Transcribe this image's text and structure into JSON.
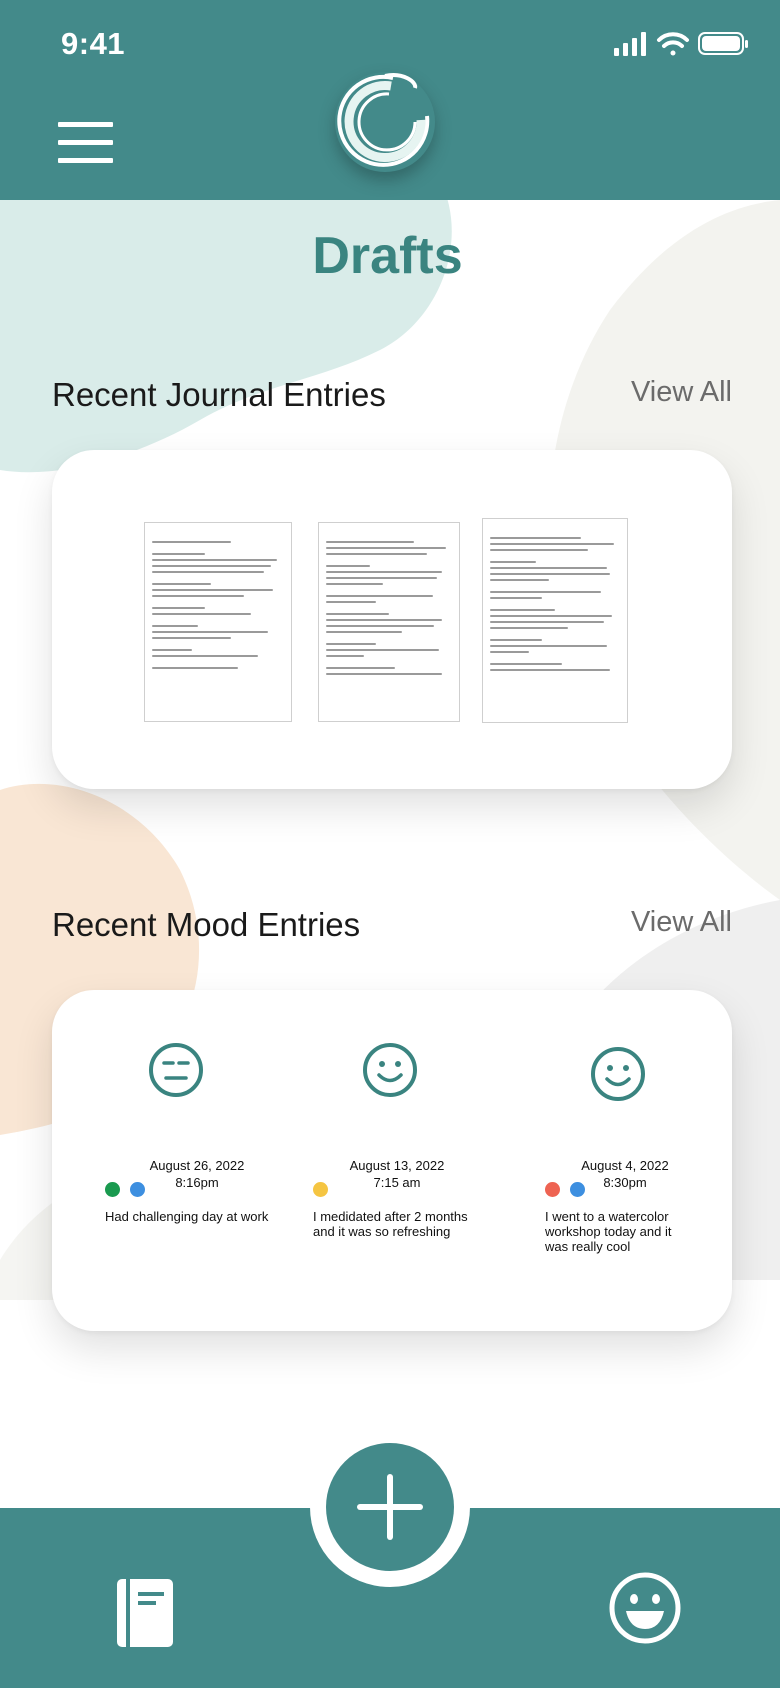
{
  "status_bar": {
    "time": "9:41"
  },
  "header": {
    "menu_icon": "hamburger-menu-icon",
    "logo_icon": "app-logo-icon"
  },
  "page": {
    "title": "Drafts"
  },
  "journal": {
    "section_title": "Recent Journal Entries",
    "view_all_label": "View All",
    "thumbnails": [
      "document-preview-1",
      "document-preview-2",
      "document-preview-3"
    ]
  },
  "mood": {
    "section_title": "Recent Mood Entries",
    "view_all_label": "View All",
    "entries": [
      {
        "date": "August 26, 2022",
        "time": "8:16pm",
        "face": "neutral-face-icon",
        "dots": [
          "#1a9a4f",
          "#3d8fe0"
        ],
        "text": "Had challenging day at work"
      },
      {
        "date": "August 13, 2022",
        "time": "7:15 am",
        "face": "smiling-face-icon",
        "dots": [
          "#f5c542"
        ],
        "text": "I medidated after 2 months and it was so refreshing"
      },
      {
        "date": "August 4, 2022",
        "time": "8:30pm",
        "face": "smiling-face-icon",
        "dots": [
          "#ee6352",
          "#3d8fe0"
        ],
        "text": "I went to a watercolor workshop today and it was really cool"
      }
    ]
  },
  "bottom_nav": {
    "add_icon": "plus-icon",
    "journal_icon": "journal-book-icon",
    "mood_icon": "happy-face-icon"
  },
  "colors": {
    "brand": "#438a8a",
    "title": "#3a8480",
    "mint_blob": "#d9ece9",
    "peach_blob": "#f9e6d4",
    "grey_blob": "#f2f2f2"
  }
}
